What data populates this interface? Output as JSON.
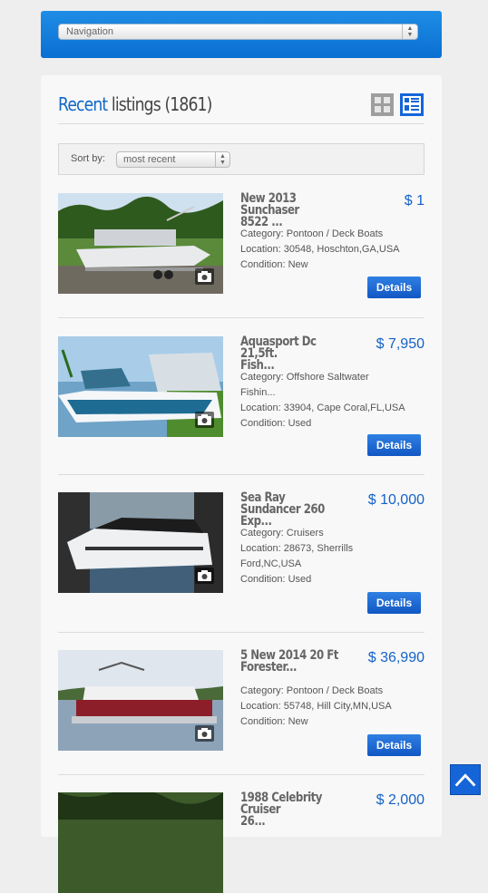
{
  "navigation": {
    "placeholder": "Navigation"
  },
  "heading": {
    "accent": "Recent",
    "rest": " listings (1861)"
  },
  "sort": {
    "label": "Sort by:",
    "value": "most recent"
  },
  "listings": [
    {
      "title": "New 2013 Sunchaser\n8522 ...",
      "price": "$ 1",
      "category": "Category: Pontoon / Deck Boats",
      "location": "Location: 30548, Hoschton,GA,USA",
      "condition": "Condition: New",
      "details_label": "Details"
    },
    {
      "title": "Aquasport Dc 21,5ft.\nFish...",
      "price": "$ 7,950",
      "category": "Category: Offshore Saltwater Fishin...",
      "location": "Location: 33904, Cape Coral,FL,USA",
      "condition": "Condition: Used",
      "details_label": "Details"
    },
    {
      "title": "Sea Ray Sundancer 260\nExp...",
      "price": "$ 10,000",
      "category": "Category: Cruisers",
      "location": "Location: 28673, Sherrills Ford,NC,USA",
      "condition": "Condition: Used",
      "details_label": "Details"
    },
    {
      "title": "5 New 2014 20 Ft\nForester...",
      "price": "$ 36,990",
      "category": "Category: Pontoon / Deck Boats",
      "location": "Location: 55748, Hill City,MN,USA",
      "condition": "Condition: New",
      "details_label": "Details"
    },
    {
      "title": "1988 Celebrity Cruiser\n26...",
      "price": "$ 2,000"
    }
  ],
  "colors": {
    "brand_blue": "#1565d8",
    "price_blue": "#1462c8",
    "nav_gradient_top": "#1f8de6"
  },
  "icons": {
    "grid_view": "grid-view-icon",
    "list_view": "list-view-icon",
    "camera": "camera-icon",
    "scroll_top": "chevron-up-icon"
  }
}
